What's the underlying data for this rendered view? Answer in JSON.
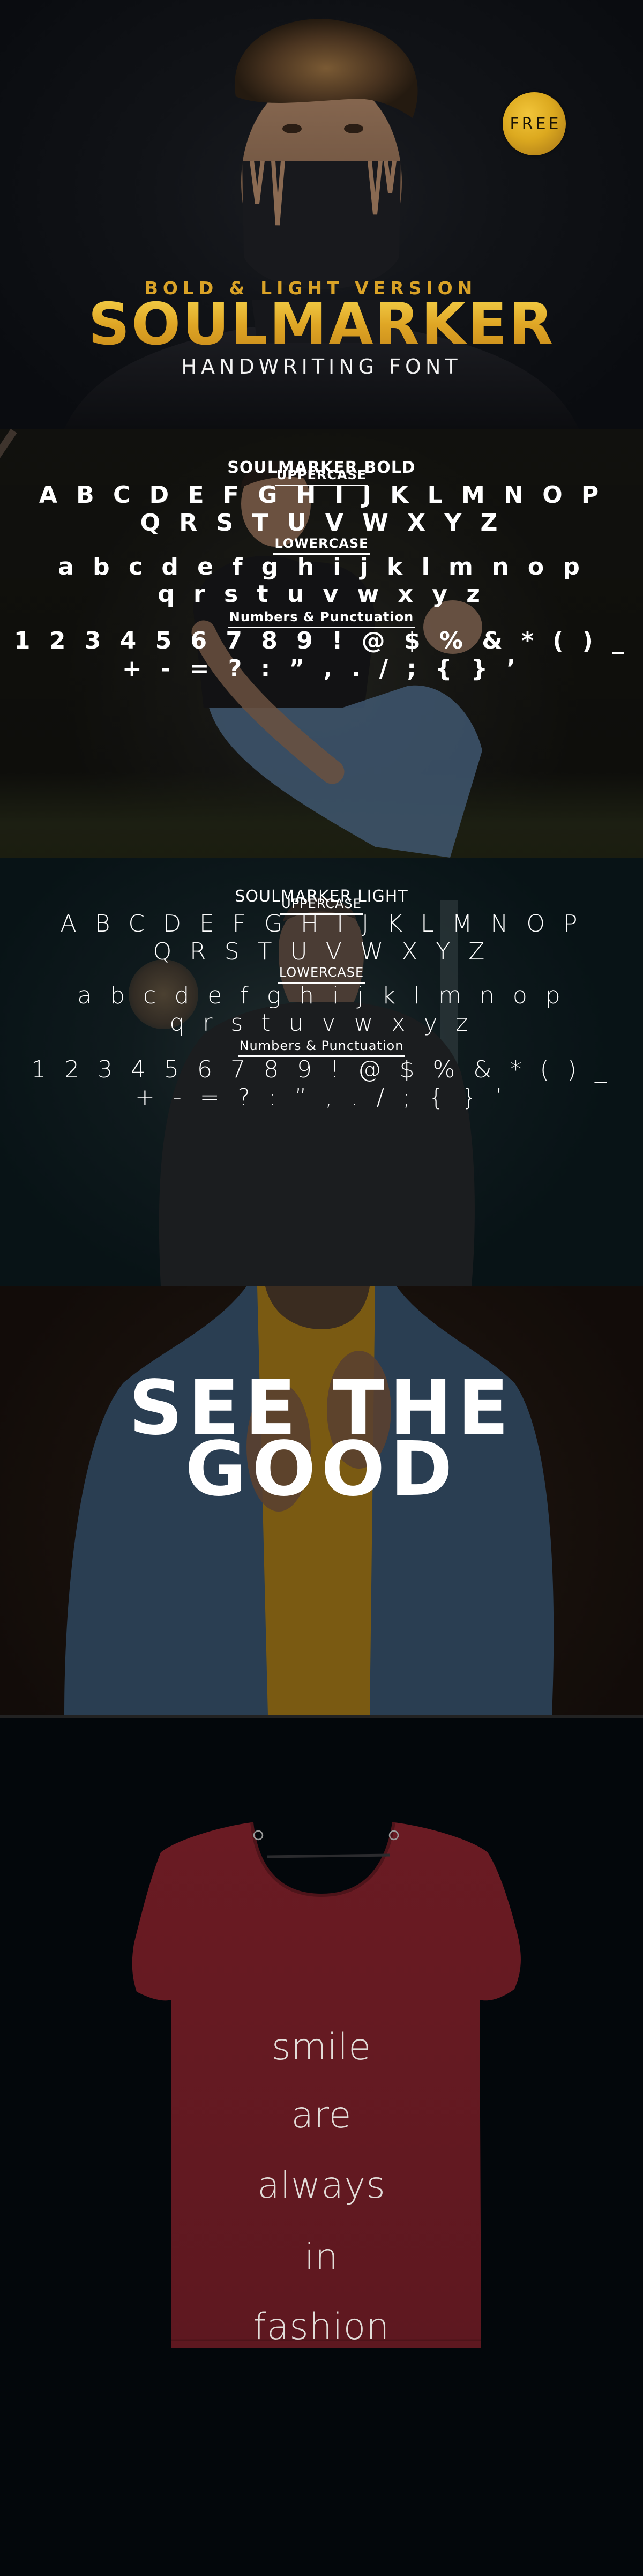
{
  "hero": {
    "badge": "FREE",
    "subtitle": "BOLD & LIGHT VERSION",
    "title": "SOULMARKER",
    "tagline": "HANDWRITING FONT",
    "colors": {
      "gold": "#e0a826",
      "badge_gold": "#dca91f",
      "background": "#0e1014"
    }
  },
  "bold_specimen": {
    "title": "SOULMARKER BOLD",
    "sections": [
      {
        "heading": "UPPERCASE",
        "rows": [
          "A B C D E F G H I J K L M N O P",
          "Q R S T U V W X Y Z"
        ]
      },
      {
        "heading": "LOWERCASE",
        "rows": [
          "a b c d e f g h i j k l m n o p",
          "q r s t u v w x y z"
        ]
      },
      {
        "heading": "Numbers & Punctuation",
        "rows": [
          "1 2 3 4 5 6 7 8 9 ! @ $ % & * ( ) _",
          "+ - = ? : ” , . / ; { } ’"
        ]
      }
    ]
  },
  "light_specimen": {
    "title": "SOULMARKER LIGHT",
    "sections": [
      {
        "heading": "UPPERCASE",
        "rows": [
          "A B C D E F G H I J K L M N O P",
          "Q R S T U V W X Y Z"
        ]
      },
      {
        "heading": "LOWERCASE",
        "rows": [
          "a b c d e f g h i j k l m n o p",
          "q r s t u v w x y z"
        ]
      },
      {
        "heading": "Numbers & Punctuation",
        "rows": [
          "1 2 3 4 5 6 7 8 9 ! @ $ % & * ( ) _",
          "+ - = ? : ” , . / ; { } ’"
        ]
      }
    ]
  },
  "showcase": {
    "lines": [
      "SEE THE",
      "GOOD"
    ]
  },
  "tshirt": {
    "lines": [
      "smile",
      "are",
      "always",
      "in",
      "fashion"
    ],
    "colors": {
      "shirt": "#6e1c24",
      "print": "#e2dcd8",
      "background": "#03070b"
    }
  }
}
